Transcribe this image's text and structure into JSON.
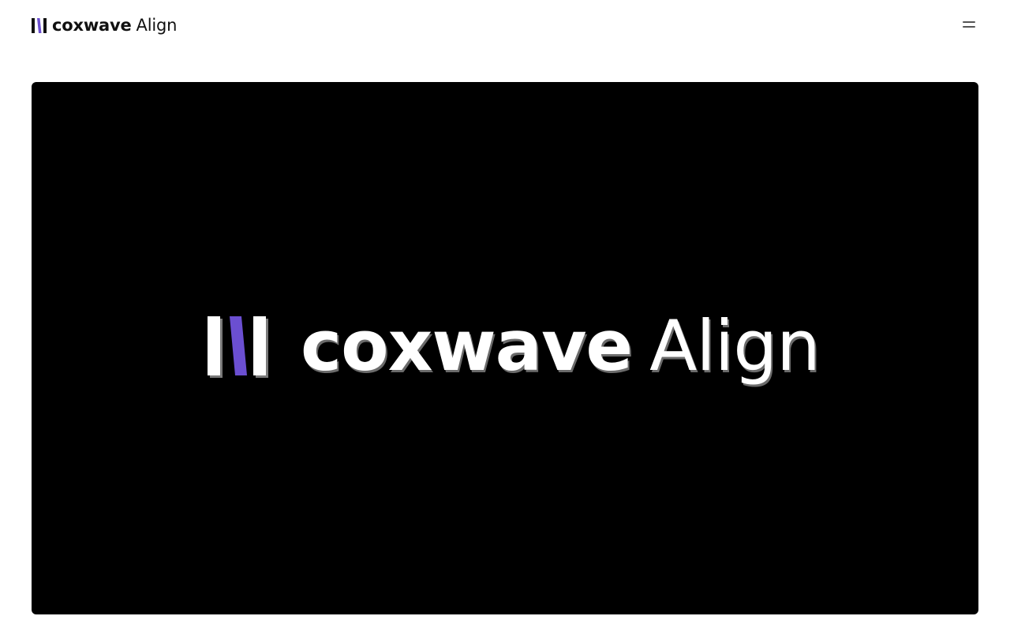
{
  "header": {
    "brand": {
      "strong": "coxwave",
      "light": "Align",
      "icon": "coxwave-bars-icon"
    },
    "menu": {
      "icon": "hamburger-menu-icon"
    }
  },
  "hero": {
    "logo": {
      "strong": "coxwave",
      "light": "Align",
      "icon": "coxwave-bars-icon"
    }
  },
  "colors": {
    "brand_purple": "#6B4FD1",
    "hero_background": "#000000",
    "text_dark": "#111111"
  }
}
